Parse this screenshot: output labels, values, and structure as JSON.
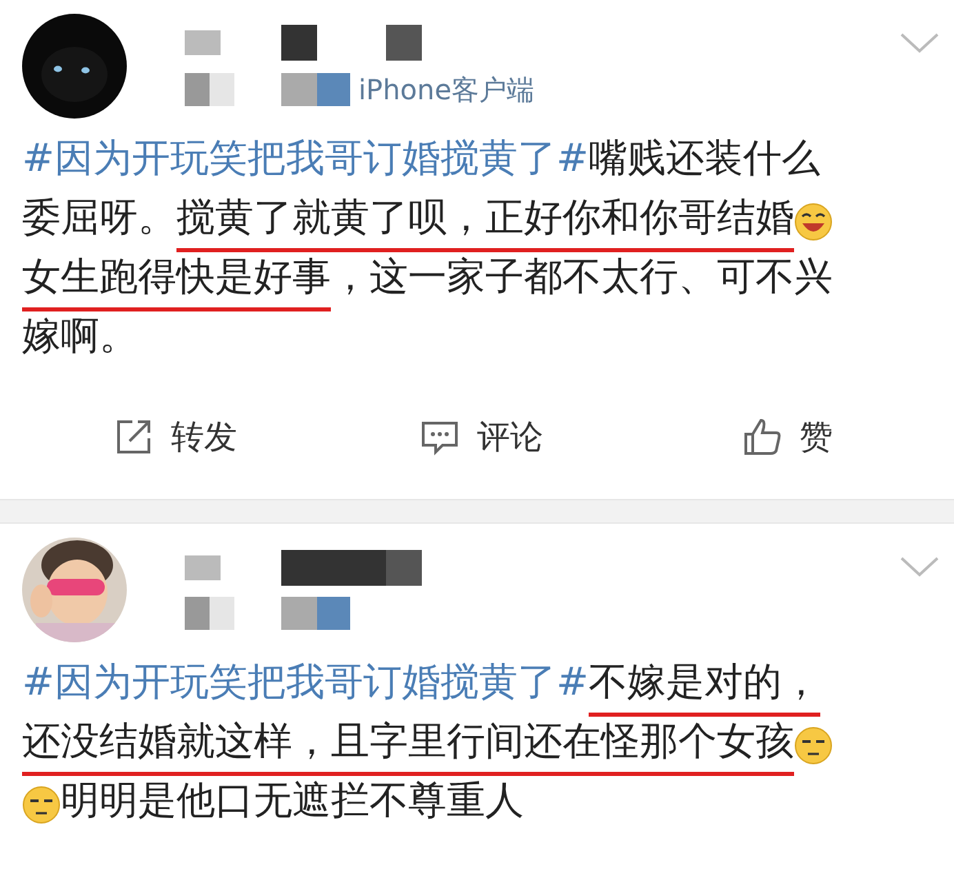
{
  "posts": [
    {
      "meta": "iPhone客户端",
      "lines": [
        [
          {
            "kind": "hashtag",
            "text": "#因为开玩笑把我哥订婚搅黄了#"
          },
          {
            "kind": "text",
            "text": " 嘴贱还装什么",
            "underlined": false
          }
        ],
        [
          {
            "kind": "text",
            "text": "委屈呀。",
            "underlined": false
          },
          {
            "kind": "text",
            "text": "搅黄了就黄了呗，",
            "underlined": true
          },
          {
            "kind": "text",
            "text": "正好你和你哥结婚",
            "underlined": true
          },
          {
            "kind": "grin_emoji"
          }
        ],
        [
          {
            "kind": "text",
            "text": "女生跑得快是好事",
            "underlined": true
          },
          {
            "kind": "text",
            "text": "，这一家子都不太行、可不兴",
            "underlined": false
          }
        ],
        [
          {
            "kind": "text",
            "text": "嫁啊。",
            "underlined": false
          }
        ]
      ],
      "actions": [
        {
          "kind": "repost",
          "label": "转发"
        },
        {
          "kind": "comment",
          "label": "评论"
        },
        {
          "kind": "like",
          "label": "赞"
        }
      ]
    },
    {
      "lines": [
        [
          {
            "kind": "hashtag",
            "text": "#因为开玩笑把我哥订婚搅黄了#"
          },
          {
            "kind": "text",
            "text": "不嫁是对的，",
            "underlined": true
          }
        ],
        [
          {
            "kind": "text",
            "text": "还没结婚就这样，且字里行间还在怪那个女孩",
            "underlined": true
          },
          {
            "kind": "flat_emoji"
          }
        ],
        [
          {
            "kind": "flat_emoji"
          },
          {
            "kind": "text",
            "text": "明明是他口无遮拦不尊重人",
            "underlined": false
          }
        ]
      ]
    }
  ]
}
